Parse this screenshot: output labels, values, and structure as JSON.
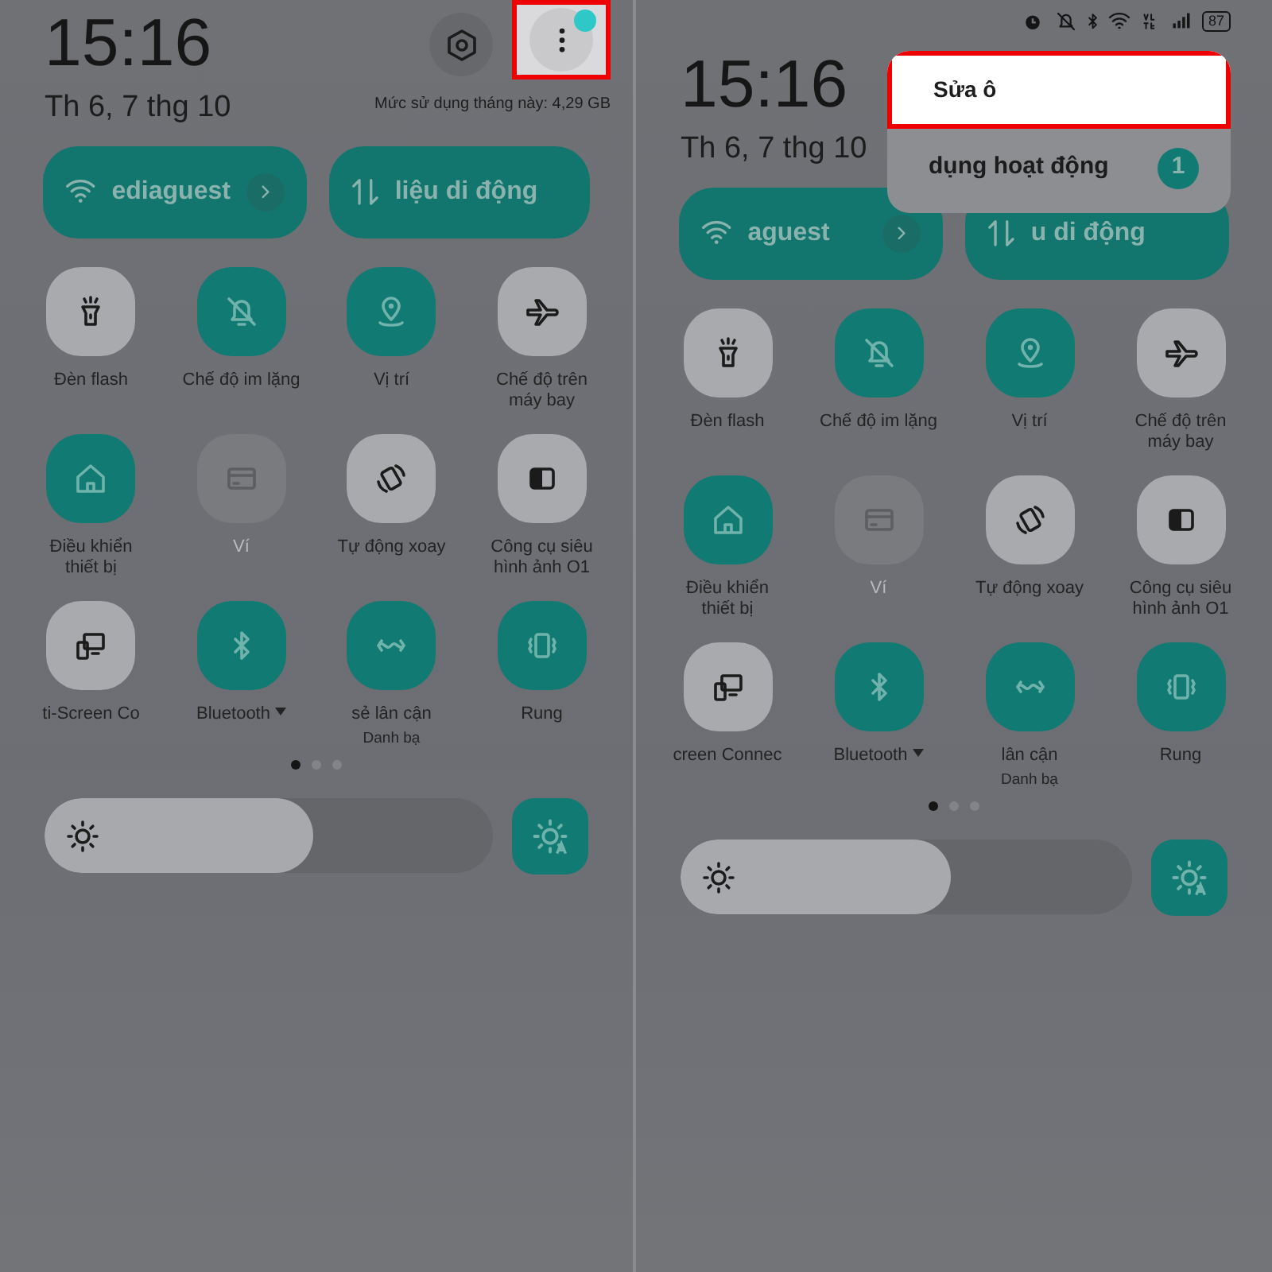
{
  "panels": [
    {
      "time": "15:16",
      "date": "Th 6, 7 thg 10",
      "header_buttons": [
        {
          "kind": "settings",
          "highlighted": false
        },
        {
          "kind": "more",
          "highlighted": true,
          "dot": true
        }
      ],
      "usage": "Mức sử dụng tháng này: 4,29 GB",
      "pills": [
        {
          "kind": "wifi",
          "label": "ediaguest",
          "arrow": true
        },
        {
          "kind": "data",
          "label": "liệu di động"
        }
      ],
      "tiles": [
        {
          "label": "Đèn flash",
          "on": false
        },
        {
          "label": "Chế độ im lặng",
          "on": true
        },
        {
          "label": "Vị trí",
          "on": true
        },
        {
          "label": "Chế độ trên máy bay",
          "on": false
        },
        {
          "label": "Điều khiển thiết bị",
          "on": true
        },
        {
          "label": "Ví",
          "on": false,
          "disabled": true
        },
        {
          "label": "Tự động xoay",
          "on": false
        },
        {
          "label": "Công cụ siêu hình ảnh O1",
          "on": false
        },
        {
          "label": "ti-Screen Co",
          "on": false
        },
        {
          "label": "Bluetooth",
          "on": true,
          "dropdown": true
        },
        {
          "label": "sẻ lân cận",
          "sublabel": "Danh bạ",
          "on": true
        },
        {
          "label": "Rung",
          "on": true
        }
      ],
      "pages": [
        {
          "selected": true
        },
        {
          "selected": false
        },
        {
          "selected": false
        }
      ],
      "brightness": {
        "level": 0.6
      }
    },
    {
      "battery": "87",
      "time": "15:16",
      "date": "Th 6, 7 thg 10",
      "pills": [
        {
          "kind": "wifi",
          "label": "aguest",
          "arrow": true
        },
        {
          "kind": "data",
          "label": "u di động"
        }
      ],
      "menu": [
        {
          "label": "Sửa ô",
          "highlighted": true
        },
        {
          "label": "dụng hoạt động",
          "badge": "1",
          "highlighted": false
        }
      ],
      "tiles": [
        {
          "label": "Đèn flash",
          "on": false
        },
        {
          "label": "Chế độ im lặng",
          "on": true
        },
        {
          "label": "Vị trí",
          "on": true
        },
        {
          "label": "Chế độ trên máy bay",
          "on": false
        },
        {
          "label": "Điều khiển thiết bị",
          "on": true
        },
        {
          "label": "Ví",
          "on": false,
          "disabled": true
        },
        {
          "label": "Tự động xoay",
          "on": false
        },
        {
          "label": "Công cụ siêu hình ảnh O1",
          "on": false
        },
        {
          "label": "creen Connec",
          "on": false
        },
        {
          "label": "Bluetooth",
          "on": true,
          "dropdown": true
        },
        {
          "label": "lân cận",
          "sublabel": "Danh bạ",
          "on": true
        },
        {
          "label": "Rung",
          "on": true
        }
      ],
      "pages": [
        {
          "selected": true
        },
        {
          "selected": false
        },
        {
          "selected": false
        }
      ],
      "brightness": {
        "level": 0.6
      }
    }
  ]
}
